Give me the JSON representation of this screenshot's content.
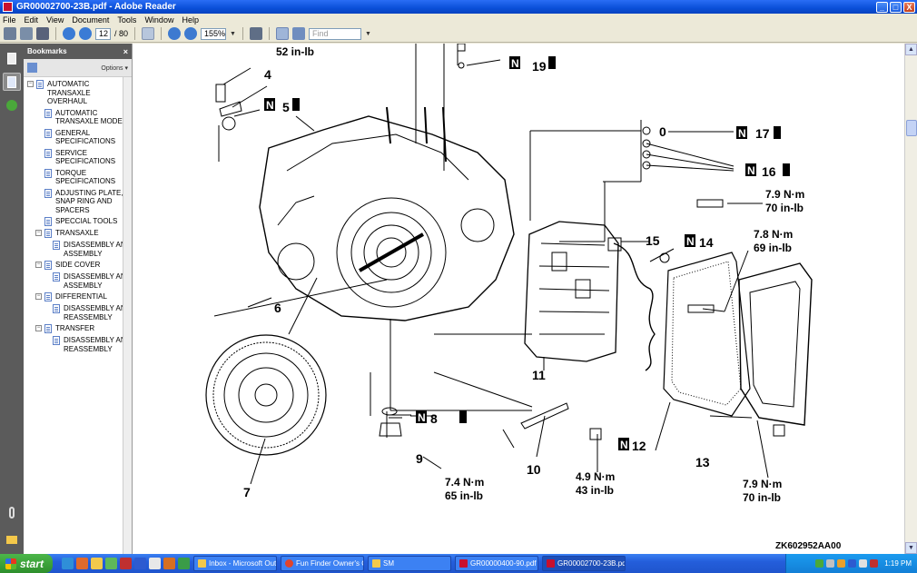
{
  "window": {
    "title": "GR00002700-23B.pdf - Adobe Reader",
    "min": "_",
    "max": "□",
    "close": "X"
  },
  "menu": [
    "File",
    "Edit",
    "View",
    "Document",
    "Tools",
    "Window",
    "Help"
  ],
  "toolbar": {
    "page_current": "12",
    "page_total": "/ 80",
    "zoom": "155%",
    "find_placeholder": "Find"
  },
  "bookmarks": {
    "title": "Bookmarks",
    "close": "×",
    "options": "Options ▾",
    "items": [
      {
        "label": "AUTOMATIC TRANSAXLE OVERHAUL",
        "level": 0,
        "toggle": "−"
      },
      {
        "label": "AUTOMATIC TRANSAXLE MODELS",
        "level": 1,
        "toggle": ""
      },
      {
        "label": "GENERAL SPECIFICATIONS",
        "level": 1,
        "toggle": ""
      },
      {
        "label": "SERVICE SPECIFICATIONS",
        "level": 1,
        "toggle": ""
      },
      {
        "label": "TORQUE SPECIFICATIONS",
        "level": 1,
        "toggle": ""
      },
      {
        "label": "ADJUSTING PLATE, SNAP RING AND SPACERS",
        "level": 1,
        "toggle": ""
      },
      {
        "label": "SPECCIAL TOOLS",
        "level": 1,
        "toggle": ""
      },
      {
        "label": "TRANSAXLE",
        "level": 1,
        "toggle": "−"
      },
      {
        "label": "DISASSEMBLY AND ASSEMBLY",
        "level": 2,
        "toggle": ""
      },
      {
        "label": "SIDE COVER",
        "level": 1,
        "toggle": "−"
      },
      {
        "label": "DISASSEMBLY AND ASSEMBLY",
        "level": 2,
        "toggle": ""
      },
      {
        "label": "DIFFERENTIAL",
        "level": 1,
        "toggle": "−"
      },
      {
        "label": "DISASSEMBLY AND REASSEMBLY",
        "level": 2,
        "toggle": ""
      },
      {
        "label": "TRANSFER",
        "level": 1,
        "toggle": "−"
      },
      {
        "label": "DISASSEMBLY AND REASSEMBLY",
        "level": 2,
        "toggle": ""
      }
    ]
  },
  "diagram": {
    "callouts": {
      "c4": "4",
      "c5": "5",
      "c6": "6",
      "c7": "7",
      "c8": "8",
      "c9": "9",
      "c10": "10",
      "c11": "11",
      "c12": "12",
      "c13": "13",
      "c14": "14",
      "c15": "15",
      "c16": "16",
      "c17": "17",
      "c19": "19",
      "c0": "0"
    },
    "n_label": "N",
    "torques": {
      "t_top": "52 in-lb",
      "t_79a_nm": "7.9 N·m",
      "t_79a_lb": "70 in-lb",
      "t_78_nm": "7.8 N·m",
      "t_78_lb": "69 in-lb",
      "t_74_nm": "7.4 N·m",
      "t_74_lb": "65 in-lb",
      "t_49_nm": "4.9 N·m",
      "t_49_lb": "43 in-lb",
      "t_79b_nm": "7.9 N·m",
      "t_79b_lb": "70 in-lb"
    },
    "figure_ref": "ZK602952AA00"
  },
  "taskbar": {
    "start": "start",
    "tasks": [
      "Inbox - Microsoft Out...",
      "Fun Finder Owner's C...",
      "SM",
      "GR00000400-90.pdf ...",
      "GR00002700-23B.pdf..."
    ],
    "clock": "1:19 PM"
  },
  "colors": {
    "title_bar": "#0a4fd8",
    "taskbar": "#245edb",
    "start": "#3a9a38",
    "pdf_icon": "#c8102e"
  }
}
